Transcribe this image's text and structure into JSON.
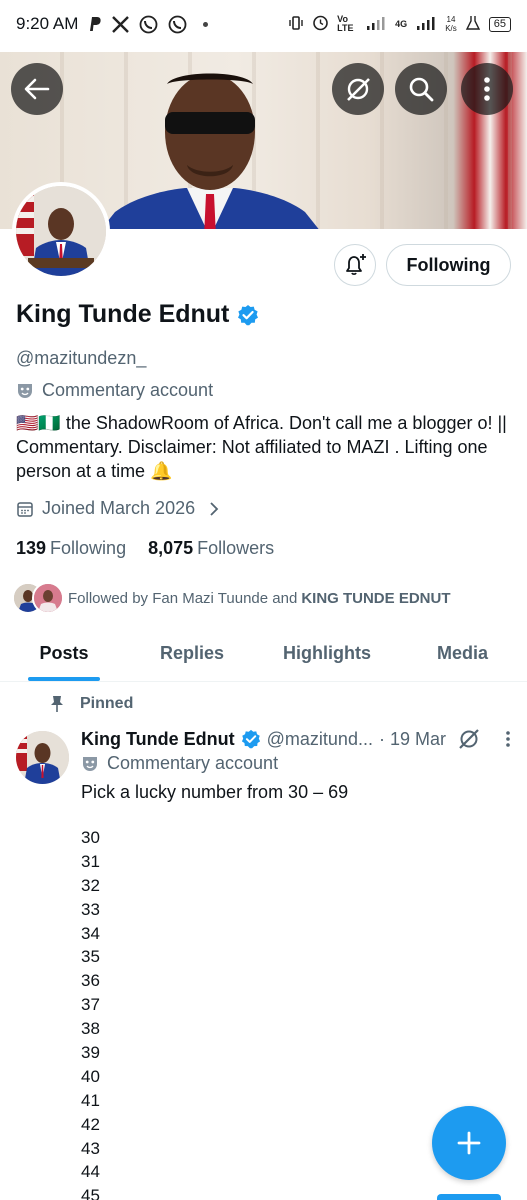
{
  "status_bar": {
    "time": "9:20 AM",
    "icons": [
      "paypal-icon",
      "x-icon",
      "whatsapp-icon",
      "whatsapp-icon"
    ],
    "network_label": "Vo LTE",
    "network_gen": "4G",
    "speed_value": "14",
    "speed_unit": "K/s",
    "battery": "65"
  },
  "header": {
    "back_icon": "back-arrow-icon",
    "grok_icon": "grok-icon",
    "search_icon": "search-icon",
    "more_icon": "more-vertical-icon"
  },
  "profile": {
    "name": "King Tunde Ednut",
    "handle": "@mazitundezn_",
    "account_label": "Commentary account",
    "bio": "🇺🇸🇳🇬 the ShadowRoom of Africa. Don't call me a blogger o! || Commentary. Disclaimer: Not affiliated to MAZI . Lifting one person at a time 🔔",
    "joined": "Joined March 2026",
    "following_count": "139",
    "following_label": "Following",
    "followers_count": "8,075",
    "followers_label": "Followers",
    "follow_button": "Following",
    "followed_by_prefix": "Followed by Fan Mazi Tuunde and",
    "followed_by_bold": "KING TUNDE EDNUT"
  },
  "tabs": [
    {
      "label": "Posts",
      "active": true
    },
    {
      "label": "Replies",
      "active": false
    },
    {
      "label": "Highlights",
      "active": false
    },
    {
      "label": "Media",
      "active": false
    }
  ],
  "post": {
    "pinned_label": "Pinned",
    "author": "King Tunde Ednut",
    "handle": "@mazitund...",
    "date": "· 19 Mar",
    "label": "Commentary account",
    "text": "Pick a lucky number from 30 – 69",
    "numbers": [
      "30",
      "31",
      "32",
      "33",
      "34",
      "35",
      "36",
      "37",
      "38",
      "39",
      "40",
      "41",
      "42",
      "43",
      "44",
      "45"
    ]
  },
  "colors": {
    "accent": "#1d9bf0",
    "text_primary": "#0f1419",
    "text_secondary": "#536471"
  }
}
